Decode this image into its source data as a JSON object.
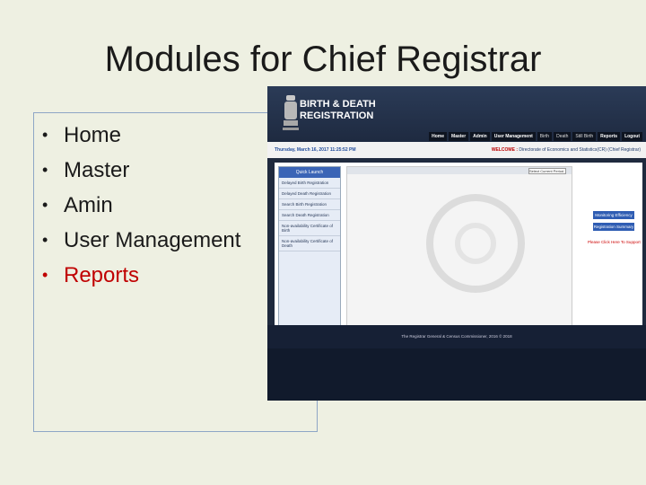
{
  "slide": {
    "title": "Modules for Chief Registrar",
    "bullet_glyph": "•",
    "bullets": [
      "Home",
      "Master",
      "Amin",
      "User Management",
      "Reports"
    ],
    "active_bullet_color": "#c00000"
  },
  "screenshot": {
    "brand_line1": "BIRTH & DEATH",
    "brand_line2": "REGISTRATION",
    "nav": [
      "Home",
      "Master",
      "Admin",
      "User Management",
      "Birth",
      "Death",
      "Still Birth",
      "Reports",
      "Logout"
    ],
    "date_text": "Thursday, March 16, 2017 11:25:52 PM",
    "welcome_label": "WELCOME :",
    "welcome_name": "Directorate of Economics and Statistics(CR) (Chief Registrar)",
    "quick_launch": {
      "title": "Quick Launch",
      "items": [
        "Delayed Birth Registration",
        "Delayed Death Registration",
        "Search Birth Registration",
        "Search Death Registration",
        "Non-availability Certificate of Birth",
        "Non-availability Certificate of Death"
      ]
    },
    "select_placeholder": "Select Current Period",
    "buttons": [
      "Monitoring Efficiency",
      "Registration Summary"
    ],
    "right_link": "Please Click Here To Support",
    "footer": "The Registrar General & Census Commissioner, 2016 © 2018"
  }
}
